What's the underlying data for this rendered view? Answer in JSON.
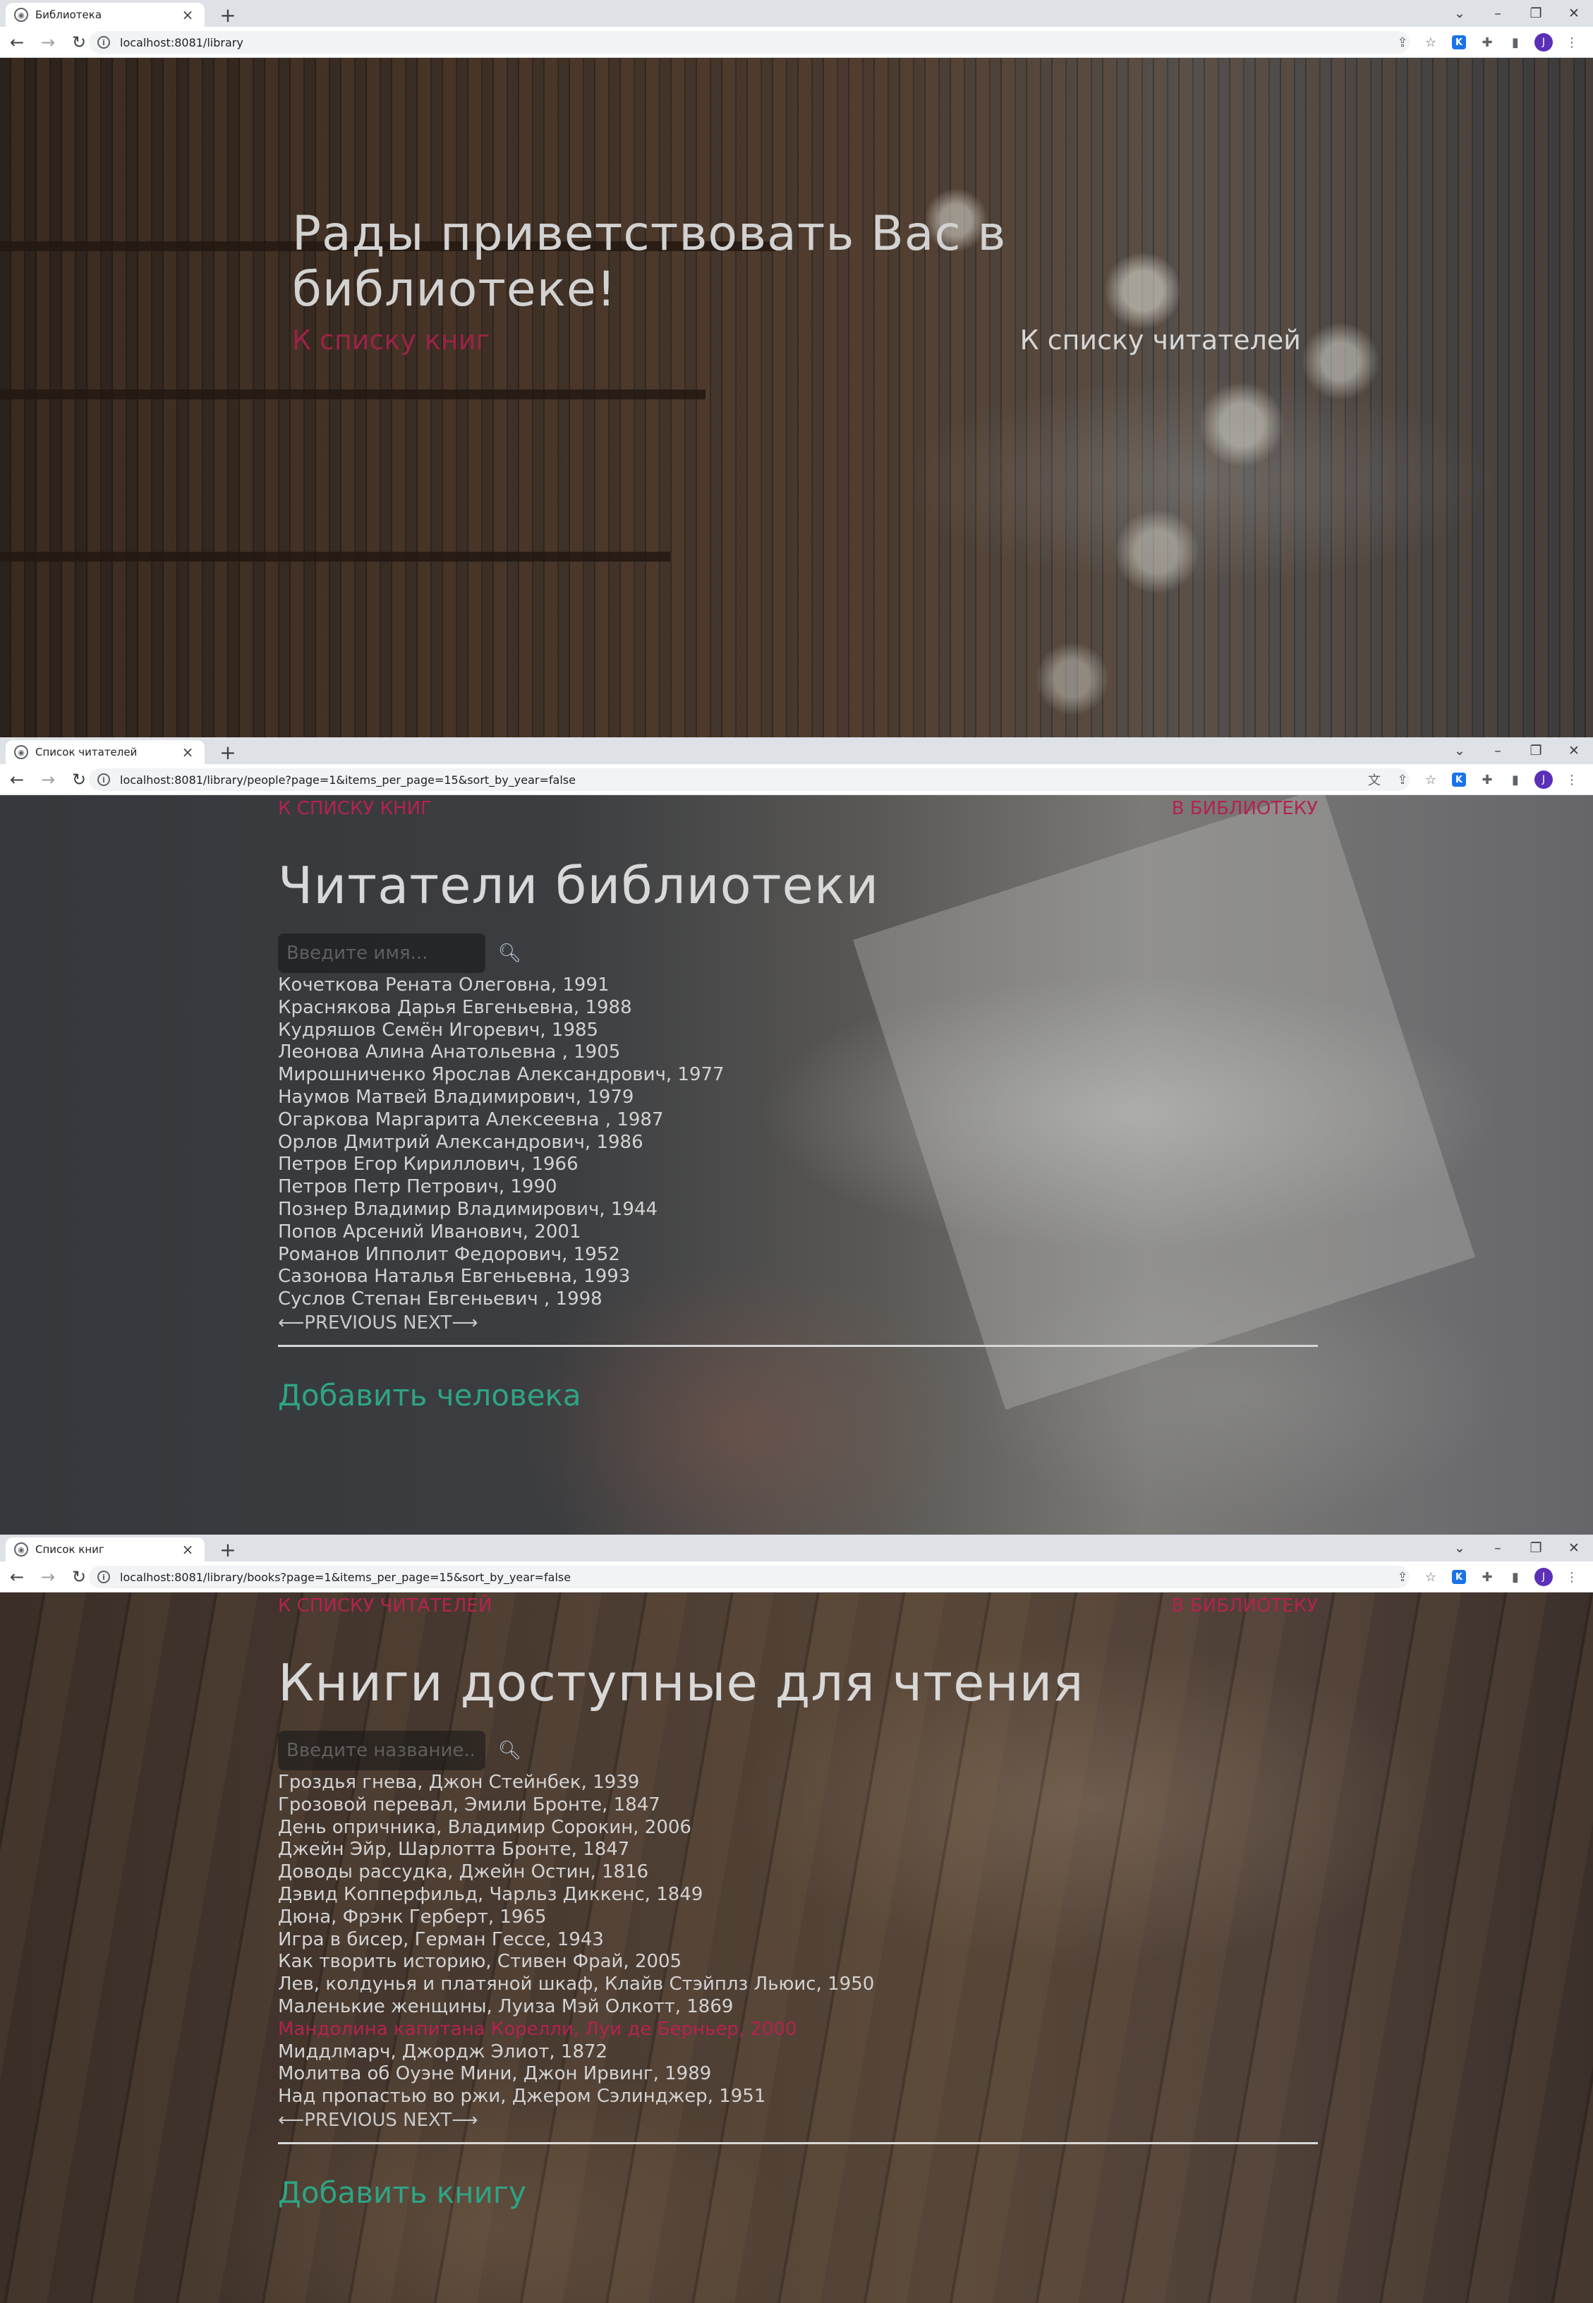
{
  "windows": [
    {
      "tab_title": "Библиотека",
      "url": "localhost:8081/library",
      "heading": "Рады приветствовать Вас в библиотеке!",
      "link_books": "К списку книг",
      "link_people": "К списку читателей"
    },
    {
      "tab_title": "Список читателей",
      "url": "localhost:8081/library/people?page=1&items_per_page=15&sort_by_year=false",
      "nav_left": "К СПИСКУ КНИГ",
      "nav_right": "В БИБЛИОТЕКУ",
      "heading": "Читатели библиотеки",
      "search_placeholder": "Введите имя...",
      "items": [
        "Кочеткова Рената Олеговна, 1991",
        "Краснякова Дарья Евгеньевна, 1988",
        "Кудряшов Семён Игоревич, 1985",
        "Леонова Алина Анатольевна , 1905",
        "Мирошниченко Ярослав Александрович, 1977",
        "Наумов Матвей Владимирович, 1979",
        "Огаркова Маргарита Алексеевна , 1987",
        "Орлов Дмитрий Александрович, 1986",
        "Петров Егор Кириллович, 1966",
        "Петров Петр Петрович, 1990",
        "Познер Владимир Владимирович, 1944",
        "Попов Арсений Иванович, 2001",
        "Романов Ипполит Федорович, 1952",
        "Сазонова Наталья Евгеньевна, 1993",
        "Суслов Степан Евгеньевич , 1998"
      ],
      "pager_prev": "⟵PREVIOUS",
      "pager_next": "NEXT⟶",
      "add_label": "Добавить человека"
    },
    {
      "tab_title": "Список книг",
      "url": "localhost:8081/library/books?page=1&items_per_page=15&sort_by_year=false",
      "nav_left": "К СПИСКУ ЧИТАТЕЛЕЙ",
      "nav_right": "В БИБЛИОТЕКУ",
      "heading": "Книги доступные для чтения",
      "search_placeholder": "Введите название...",
      "items": [
        "Гроздья гнева, Джон Стейнбек, 1939",
        "Грозовой перевал, Эмили Бронте, 1847",
        "День опричника, Владимир Сорокин, 2006",
        "Джейн Эйр, Шарлотта Бронте, 1847",
        "Доводы рассудка, Джейн Остин, 1816",
        "Дэвид Копперфильд, Чарльз Диккенс, 1849",
        "Дюна, Фрэнк Герберт, 1965",
        "Игра в бисер, Герман Гессе, 1943",
        "Как творить историю, Стивен Фрай, 2005",
        "Лев, колдунья и платяной шкаф, Клайв Стэйплз Льюис, 1950",
        "Маленькие женщины, Луиза Мэй Олкотт, 1869",
        "Мандолина капитана Корелли, Луи де Берньер, 2000",
        "Миддлмарч, Джордж Элиот, 1872",
        "Молитва об Оуэне Мини, Джон Ирвинг, 1989",
        "Над пропастью во ржи, Джером Сэлинджер, 1951"
      ],
      "highlighted_index": 11,
      "pager_prev": "⟵PREVIOUS",
      "pager_next": "NEXT⟶",
      "add_label": "Добавить книгу"
    }
  ],
  "avatar_letter": "J",
  "colors": {
    "accent_red": "#b4234e",
    "accent_green": "#2ea484",
    "text_light": "#d2d2d2"
  }
}
